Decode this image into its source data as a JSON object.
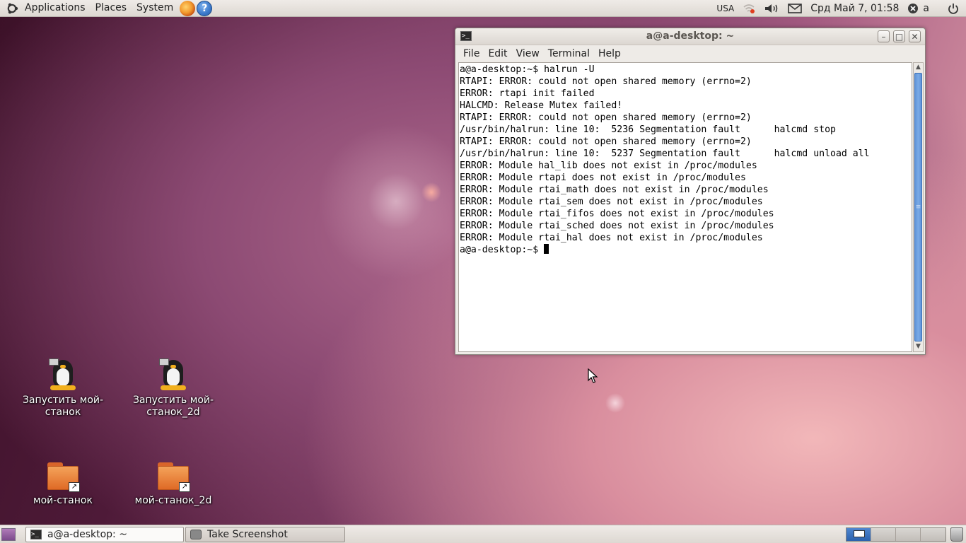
{
  "top_panel": {
    "menus": [
      "Applications",
      "Places",
      "System"
    ],
    "keyboard_layout": "USA",
    "clock": "Срд Май  7, 01:58",
    "user": "a"
  },
  "terminal": {
    "title": "a@a-desktop: ~",
    "menu": [
      "File",
      "Edit",
      "View",
      "Terminal",
      "Help"
    ],
    "lines": [
      "a@a-desktop:~$ halrun -U",
      "RTAPI: ERROR: could not open shared memory (errno=2)",
      "ERROR: rtapi init failed",
      "HALCMD: Release Mutex failed!",
      "RTAPI: ERROR: could not open shared memory (errno=2)",
      "/usr/bin/halrun: line 10:  5236 Segmentation fault      halcmd stop",
      "RTAPI: ERROR: could not open shared memory (errno=2)",
      "/usr/bin/halrun: line 10:  5237 Segmentation fault      halcmd unload all",
      "ERROR: Module hal_lib does not exist in /proc/modules",
      "ERROR: Module rtapi does not exist in /proc/modules",
      "ERROR: Module rtai_math does not exist in /proc/modules",
      "ERROR: Module rtai_sem does not exist in /proc/modules",
      "ERROR: Module rtai_fifos does not exist in /proc/modules",
      "ERROR: Module rtai_sched does not exist in /proc/modules",
      "ERROR: Module rtai_hal does not exist in /proc/modules"
    ],
    "prompt": "a@a-desktop:~$ "
  },
  "desktop_icons": [
    {
      "label": "Запустить мой-станок",
      "type": "launcher"
    },
    {
      "label": "Запустить мой-станок_2d",
      "type": "launcher"
    },
    {
      "label": "мой-станок",
      "type": "folder-link"
    },
    {
      "label": "мой-станок_2d",
      "type": "folder-link"
    }
  ],
  "taskbar": {
    "tasks": [
      "a@a-desktop: ~",
      "Take Screenshot"
    ]
  },
  "workspaces_count": 4,
  "active_workspace": 1
}
